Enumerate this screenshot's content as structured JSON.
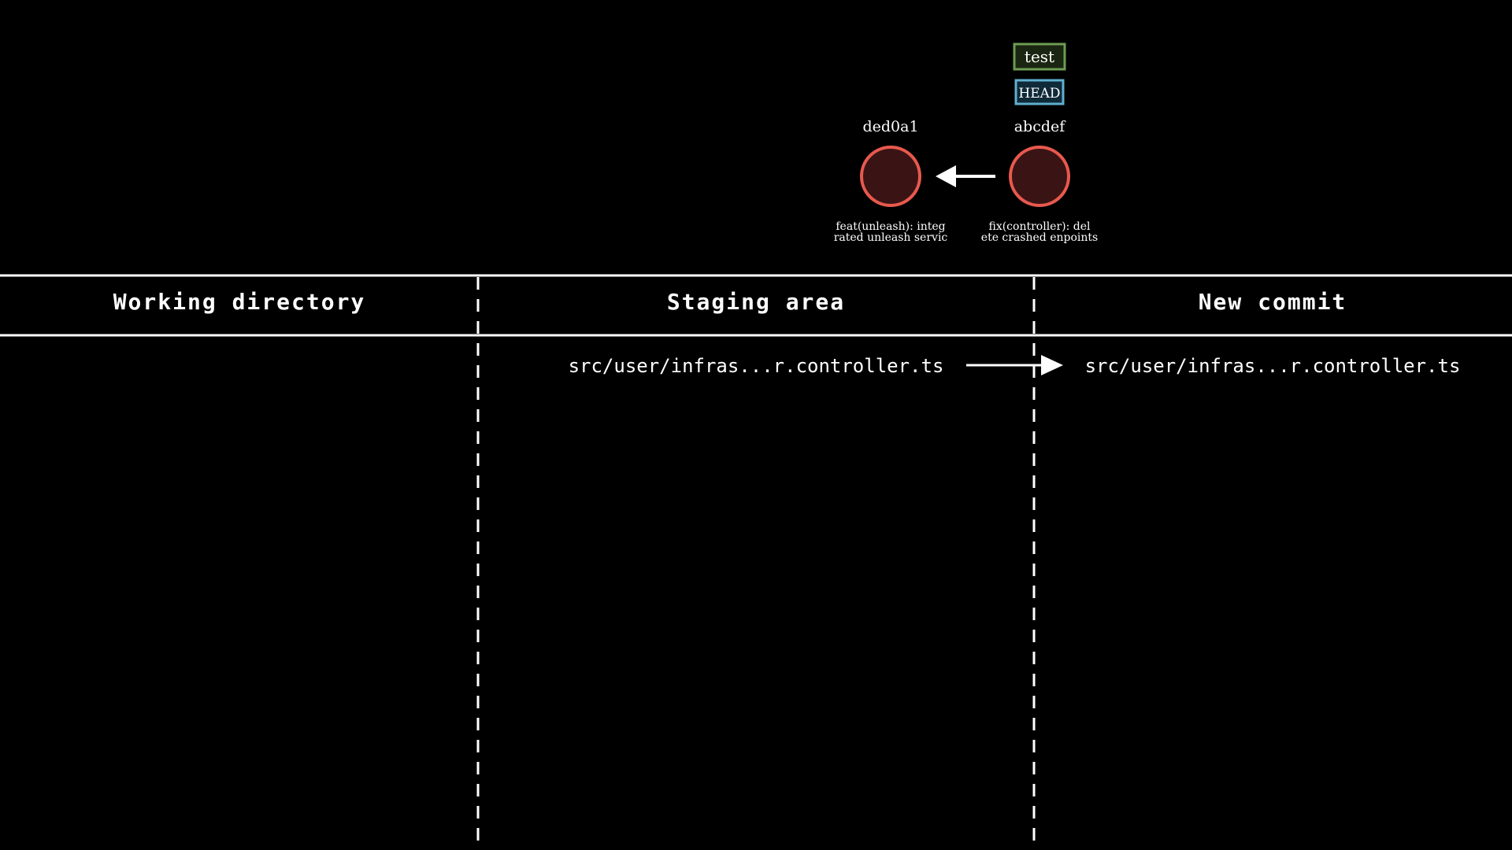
{
  "colors": {
    "background": "#000000",
    "commit_fill": "#3a1414",
    "commit_stroke": "#e8594e",
    "branch_border": "#6e9c52",
    "branch_fill": "#1a2612",
    "head_border": "#5fb0cf",
    "head_fill": "#0f2a38",
    "line": "#ffffff"
  },
  "refs": {
    "branch_label": "test",
    "head_label": "HEAD"
  },
  "commits": [
    {
      "hash": "ded0a1",
      "message_line1": "feat(unleash): integ",
      "message_line2": "rated unleash servic"
    },
    {
      "hash": "abcdef",
      "message_line1": "fix(controller): del",
      "message_line2": "ete crashed enpoints"
    }
  ],
  "columns": {
    "working_directory": "Working directory",
    "staging_area": "Staging area",
    "new_commit": "New commit"
  },
  "files": {
    "staged": "src/user/infras...r.controller.ts",
    "committed": "src/user/infras...r.controller.ts"
  }
}
